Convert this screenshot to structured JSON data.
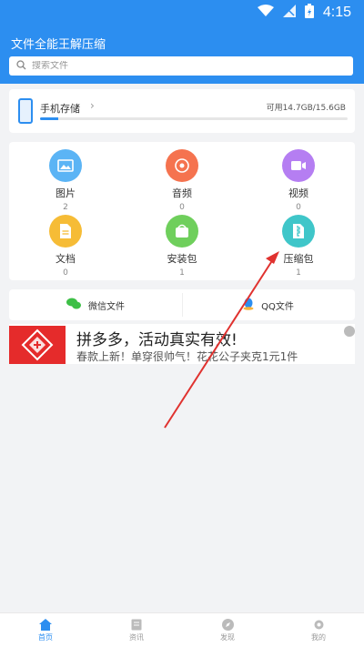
{
  "status_bar": {
    "time": "4:15"
  },
  "app": {
    "title": "文件全能王解压缩"
  },
  "search": {
    "placeholder": "搜索文件"
  },
  "storage": {
    "label": "手机存储",
    "available": "可用14.7GB/15.6GB",
    "used_fraction": 0.06
  },
  "categories": [
    {
      "label": "图片",
      "count": "2",
      "color": "#5bb4f5",
      "icon": "image-icon"
    },
    {
      "label": "音频",
      "count": "0",
      "color": "#f5734f",
      "icon": "music-icon"
    },
    {
      "label": "视频",
      "count": "0",
      "color": "#b57ef2",
      "icon": "video-icon"
    },
    {
      "label": "文档",
      "count": "0",
      "color": "#f6bc36",
      "icon": "document-icon"
    },
    {
      "label": "安装包",
      "count": "1",
      "color": "#6fcf5c",
      "icon": "package-icon"
    },
    {
      "label": "压缩包",
      "count": "1",
      "color": "#3fc6c9",
      "icon": "zip-icon"
    }
  ],
  "share": {
    "wechat": "微信文件",
    "qq": "QQ文件"
  },
  "ad": {
    "title": "拼多多，活动真实有效!",
    "subtitle": "春款上新！单穿很帅气！花花公子夹克1元1件"
  },
  "bottom_nav": [
    "首页",
    "资讯",
    "发现",
    "我的"
  ],
  "colors": {
    "primary": "#2c8ef0",
    "annotation": "#e0322f"
  }
}
